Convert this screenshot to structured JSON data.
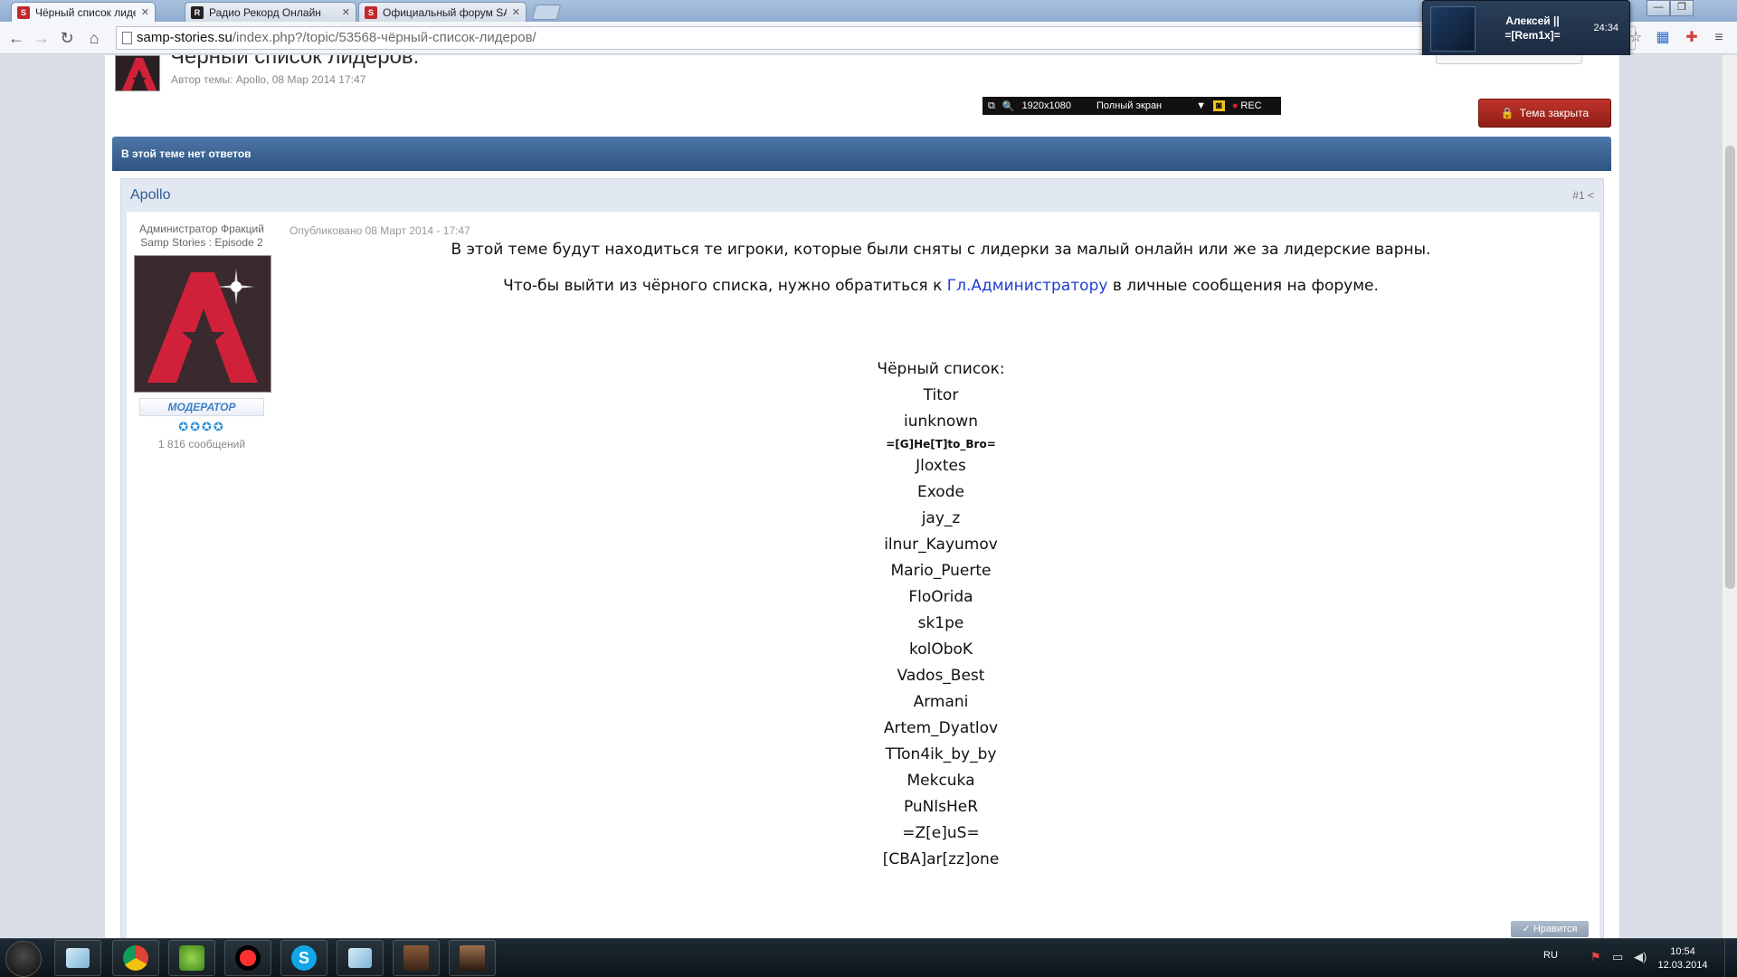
{
  "browser": {
    "tabs": [
      {
        "label": "Чёрный список лидеров",
        "favicon": "SS"
      },
      {
        "label": "Радио Рекорд Онлайн",
        "favicon": "rec"
      },
      {
        "label": "Официальный форум SA",
        "favicon": "SS"
      }
    ],
    "url_host": "samp-stories.su",
    "url_path": "/index.php?/topic/53568-чёрный-список-лидеров/"
  },
  "notification": {
    "name_line1": "Алексей ||",
    "name_line2": "=[Rem1x]=",
    "duration": "24:34"
  },
  "recorder": {
    "resolution": "1920x1080",
    "mode": "Полный экран",
    "rec_label": "REC"
  },
  "topic": {
    "title": "Чёрный список лидеров.",
    "meta": "Автор темы: Apollo, 08 Мар 2014 17:47",
    "locked_label": "Тема закрыта",
    "no_replies": "В этой теме нет ответов"
  },
  "post": {
    "author": "Apollo",
    "number": "#1",
    "author_title_1": "Администратор Фракций",
    "author_title_2": "Samp Stories : Episode 2",
    "role": "МОДЕРАТОР",
    "post_count": "1 816 сообщений",
    "published": "Опубликовано 08 Март 2014 - 17:47",
    "para1": "В этой теме будут находиться те игроки, которые были сняты с лидерки за малый онлайн или же за лидерские варны.",
    "para2_before": "Что-бы выйти из чёрного списка, нужно обратиться к ",
    "para2_link": "Гл.Администратору",
    "para2_after": " в личные сообщения на форуме.",
    "blacklist_title": "Чёрный список:",
    "blacklist": [
      "Titor",
      "iunknown",
      "=[G]He[T]to_Bro=",
      "Jloxtes",
      "Exode",
      "jay_z",
      "ilnur_Kayumov",
      "Mario_Puerte",
      "FloOrida",
      "sk1pe",
      "kolOboK",
      "Vados_Best",
      "Armani",
      "Artem_Dyatlov",
      "TTon4ik_by_by",
      "Mekcuka",
      "PuNlsHeR",
      "=Z[e]uS=",
      "[CBA]ar[zz]one"
    ],
    "like_label": "Нравится"
  },
  "taskbar": {
    "lang": "RU",
    "time": "10:54",
    "date": "12.03.2014"
  }
}
